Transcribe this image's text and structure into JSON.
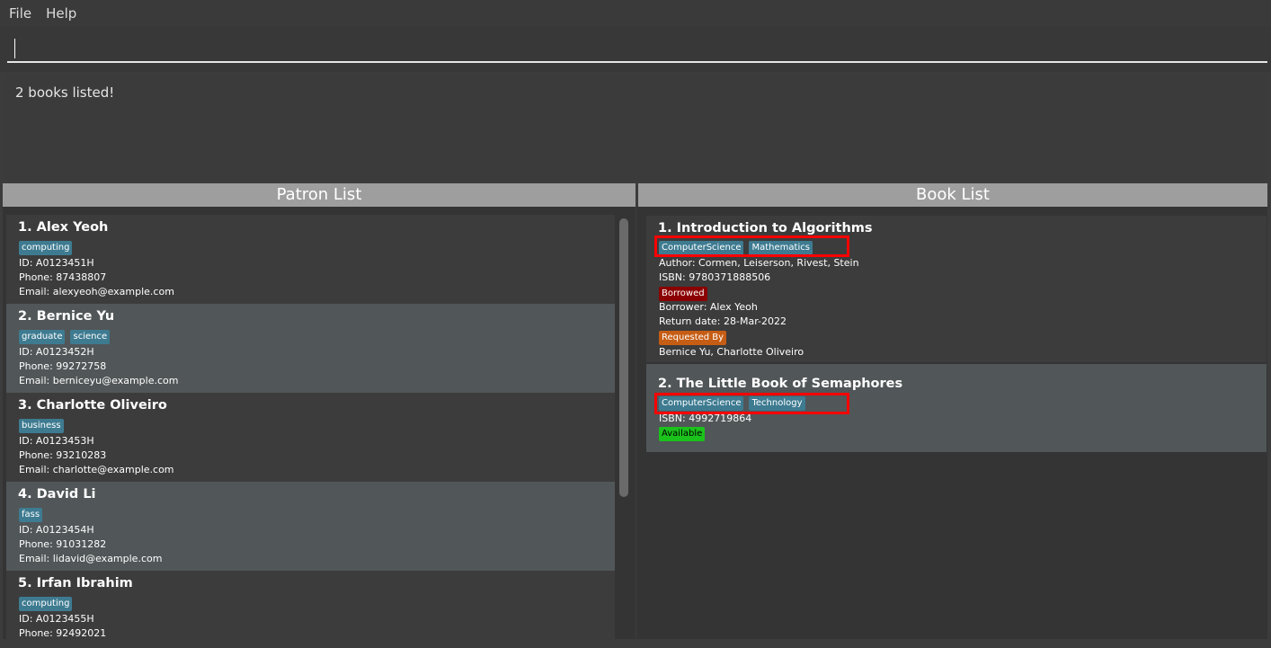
{
  "menu": {
    "file": "File",
    "help": "Help"
  },
  "command": {
    "value": ""
  },
  "result": {
    "text": "2 books listed!"
  },
  "patron_panel": {
    "title": "Patron List",
    "patrons": [
      {
        "title": "1.  Alex Yeoh",
        "tags": [
          "computing"
        ],
        "id": "ID: A0123451H",
        "phone": "Phone: 87438807",
        "email": "Email: alexyeoh@example.com"
      },
      {
        "title": "2.  Bernice Yu",
        "tags": [
          "graduate",
          "science"
        ],
        "id": "ID: A0123452H",
        "phone": "Phone: 99272758",
        "email": "Email: berniceyu@example.com"
      },
      {
        "title": "3.  Charlotte Oliveiro",
        "tags": [
          "business"
        ],
        "id": "ID: A0123453H",
        "phone": "Phone: 93210283",
        "email": "Email: charlotte@example.com"
      },
      {
        "title": "4.  David Li",
        "tags": [
          "fass"
        ],
        "id": "ID: A0123454H",
        "phone": "Phone: 91031282",
        "email": "Email: lidavid@example.com"
      },
      {
        "title": "5.  Irfan Ibrahim",
        "tags": [
          "computing"
        ],
        "id": "ID: A0123455H",
        "phone": "Phone: 92492021",
        "email": ""
      }
    ]
  },
  "book_panel": {
    "title": "Book List",
    "books": [
      {
        "title": "1.  Introduction to Algorithms",
        "tags": [
          "ComputerScience",
          "Mathematics"
        ],
        "author": "Author: Cormen, Leiserson, Rivest, Stein",
        "isbn": "ISBN: 9780371888506",
        "status": "Borrowed",
        "borrower": "Borrower: Alex Yeoh",
        "return_date": "Return date: 28-Mar-2022",
        "requested_label": "Requested By",
        "requesters": "Bernice Yu, Charlotte Oliveiro"
      },
      {
        "title": "2.  The Little Book of Semaphores",
        "tags": [
          "ComputerScience",
          "Technology"
        ],
        "isbn": "ISBN: 4992719864",
        "status": "Available"
      }
    ]
  },
  "colors": {
    "tag": "#3e7b91",
    "borrowed": "#8b0000",
    "requested": "#c65d14",
    "available": "#1cc21c",
    "highlight": "#ff0000"
  }
}
